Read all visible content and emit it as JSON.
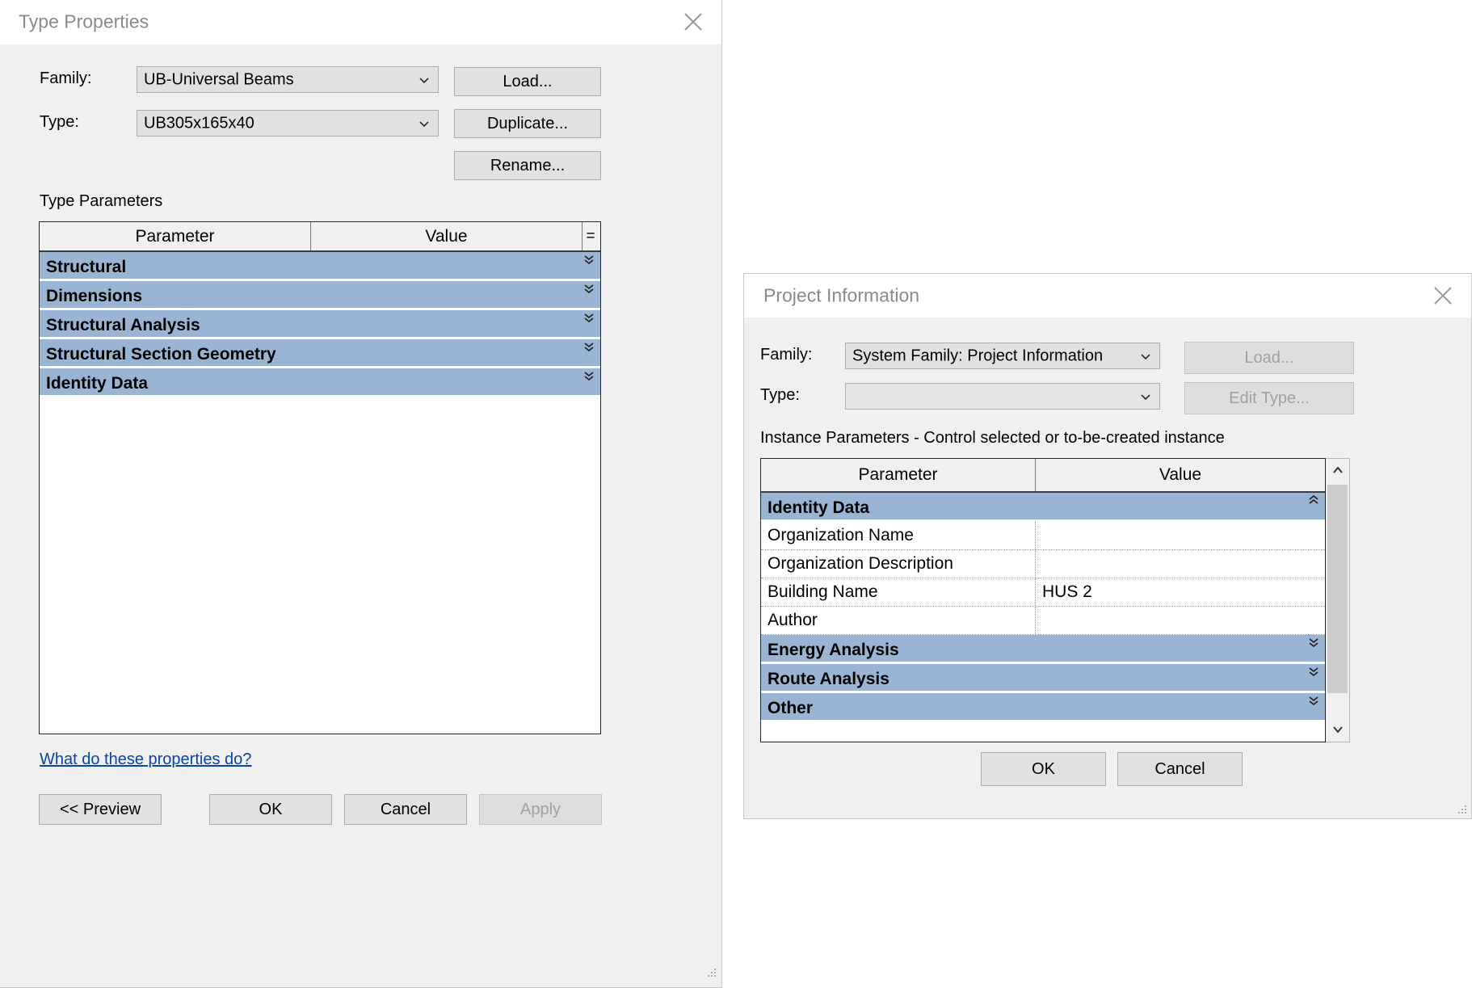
{
  "type_properties": {
    "title": "Type Properties",
    "close_icon": "close-icon",
    "family_label": "Family:",
    "family_value": "UB-Universal Beams",
    "type_label": "Type:",
    "type_value": "UB305x165x40",
    "load_button": "Load...",
    "duplicate_button": "Duplicate...",
    "rename_button": "Rename...",
    "parameters_caption": "Type Parameters",
    "columns": [
      "Parameter",
      "Value",
      "="
    ],
    "groups": [
      {
        "label": "Structural",
        "state": "collapsed"
      },
      {
        "label": "Dimensions",
        "state": "collapsed"
      },
      {
        "label": "Structural Analysis",
        "state": "collapsed"
      },
      {
        "label": "Structural Section Geometry",
        "state": "collapsed"
      },
      {
        "label": "Identity Data",
        "state": "collapsed"
      }
    ],
    "help_link": "What do these properties do?",
    "preview_button": "<< Preview",
    "ok_button": "OK",
    "cancel_button": "Cancel",
    "apply_button": "Apply"
  },
  "project_information": {
    "title": "Project Information",
    "close_icon": "close-icon",
    "family_label": "Family:",
    "family_value": "System Family: Project Information",
    "type_label": "Type:",
    "type_value": "",
    "load_button": "Load...",
    "edit_type_button": "Edit Type...",
    "parameters_caption": "Instance Parameters - Control selected or to-be-created instance",
    "columns": [
      "Parameter",
      "Value"
    ],
    "rows": [
      {
        "kind": "group",
        "label": "Identity Data",
        "state": "expanded"
      },
      {
        "kind": "param",
        "name": "Organization Name",
        "value": ""
      },
      {
        "kind": "param",
        "name": "Organization Description",
        "value": ""
      },
      {
        "kind": "param",
        "name": "Building Name",
        "value": "HUS 2"
      },
      {
        "kind": "param",
        "name": "Author",
        "value": ""
      },
      {
        "kind": "group",
        "label": "Energy Analysis",
        "state": "collapsed"
      },
      {
        "kind": "group",
        "label": "Route Analysis",
        "state": "collapsed"
      },
      {
        "kind": "group",
        "label": "Other",
        "state": "collapsed"
      }
    ],
    "ok_button": "OK",
    "cancel_button": "Cancel"
  },
  "colors": {
    "group_row_blue": "#9ab5d4",
    "dialog_face": "#f0f0f0",
    "titlebar": "#ffffff",
    "link": "#0645ad",
    "button_face": "#e1e1e1",
    "scroll_thumb": "#cdcdcd"
  }
}
